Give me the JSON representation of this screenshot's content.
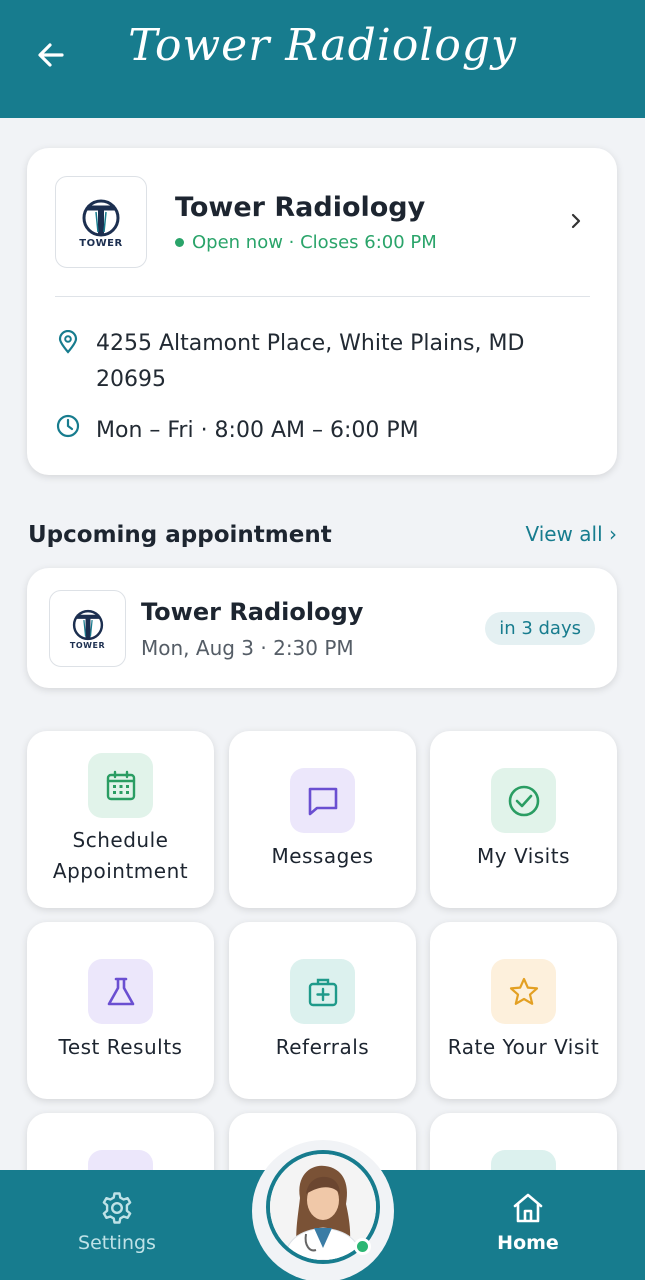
{
  "header": {
    "title": "Tower Radiology"
  },
  "location": {
    "name": "Tower Radiology",
    "logo_text": "TOWER",
    "status": "Open now · Closes 6:00 PM",
    "address": "4255 Altamont Place, White Plains, MD 20695",
    "hours": "Mon – Fri · 8:00 AM – 6:00 PM"
  },
  "upcoming": {
    "section_title": "Upcoming appointment",
    "view_all": "View all ›",
    "name": "Tower Radiology",
    "logo_text": "TOWER",
    "datetime": "Mon, Aug 3 · 2:30 PM",
    "badge": "in 3 days"
  },
  "tiles": [
    {
      "label_line1": "Schedule",
      "label_line2": "Appointment",
      "icon": "calendar-icon"
    },
    {
      "label": "Messages",
      "icon": "message-icon"
    },
    {
      "label": "My Visits",
      "icon": "check-circle-icon"
    },
    {
      "label": "Test Results",
      "icon": "flask-icon"
    },
    {
      "label": "Referrals",
      "icon": "medical-kit-icon"
    },
    {
      "label": "Rate Your Visit",
      "icon": "star-icon"
    }
  ],
  "nav": {
    "settings": "Settings",
    "home": "Home"
  },
  "colors": {
    "primary": "#177c8e",
    "open_green": "#2aa46a",
    "background": "#f1f3f6"
  }
}
